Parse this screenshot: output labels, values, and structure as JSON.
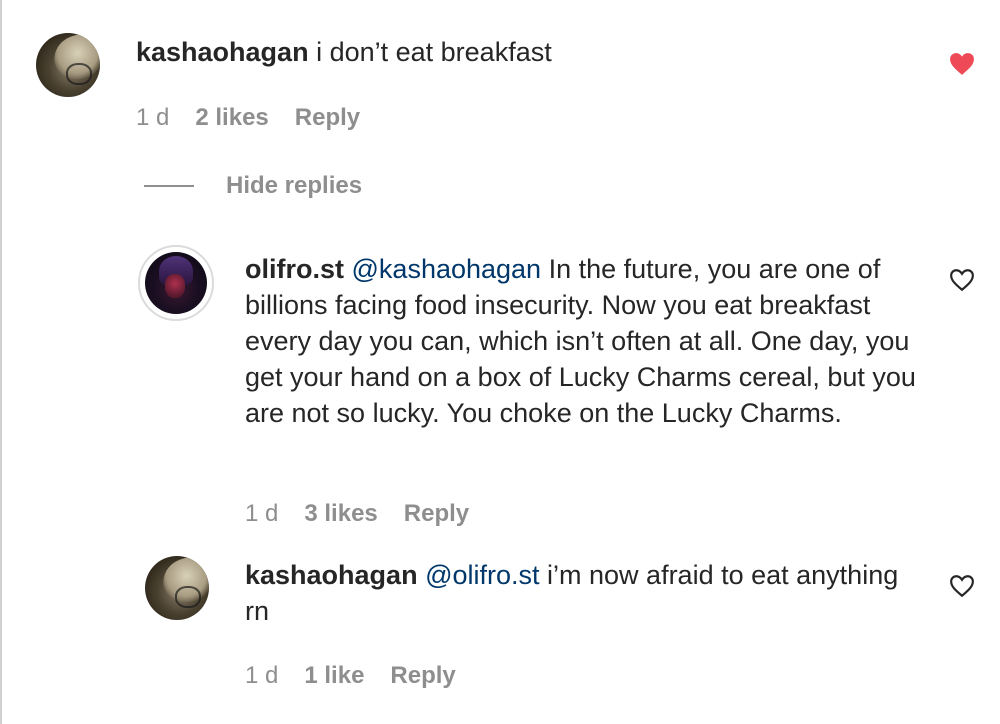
{
  "comments": {
    "top": {
      "username": "kashaohagan",
      "text": "i don’t eat breakfast",
      "time": "1 d",
      "likes": "2 likes",
      "reply": "Reply",
      "liked": true
    },
    "hide_replies_label": "Hide replies",
    "replies": [
      {
        "username": "olifro.st",
        "mention": "@kashaohagan",
        "text": "In the future, you are one of billions facing food insecurity. Now you eat breakfast every day you can, which isn’t often at all. One day, you get your hand on a box of Lucky Charms cereal, but you are not so lucky. You choke on the Lucky Charms.",
        "time": "1 d",
        "likes": "3 likes",
        "reply": "Reply",
        "liked": false
      },
      {
        "username": "kashaohagan",
        "mention": "@olifro.st",
        "text": "i’m now afraid to eat anything rn",
        "time": "1 d",
        "likes": "1 like",
        "reply": "Reply",
        "liked": false
      }
    ]
  },
  "colors": {
    "liked_heart": "#ed4956",
    "mention": "#00376b",
    "meta": "#8e8e8e",
    "text": "#262626"
  },
  "icons": {
    "liked": "heart-filled-icon",
    "unliked": "heart-outline-icon"
  }
}
